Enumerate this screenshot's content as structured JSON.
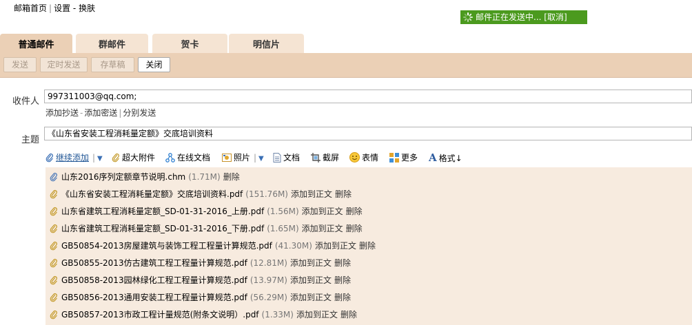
{
  "topnav": {
    "home": "邮箱首页",
    "sep": "|",
    "settings": "设置",
    "dash": "-",
    "skin": "换肤"
  },
  "status": {
    "text": "邮件正在发送中... [取消]"
  },
  "tabs": [
    "普通邮件",
    "群邮件",
    "贺卡",
    "明信片"
  ],
  "toolbar": {
    "send": "发送",
    "schedule": "定时发送",
    "draft": "存草稿",
    "close": "关闭"
  },
  "form": {
    "to_label": "收件人",
    "to_value": "997311003@qq.com;",
    "add_cc": "添加抄送",
    "add_bcc": "添加密送",
    "separate": "分别发送",
    "dash": "-",
    "bar": "|",
    "subject_label": "主题",
    "subject_value": "《山东省安装工程消耗量定额》交底培训资料"
  },
  "attach_toolbar": {
    "continue_add": "继续添加",
    "big_attach": "超大附件",
    "online_doc": "在线文档",
    "photo": "照片",
    "doc": "文档",
    "screenshot": "截屏",
    "emoji": "表情",
    "more": "更多",
    "format": "格式↓"
  },
  "attachments": [
    {
      "name": "山东2016序列定额章节说明.chm",
      "size": "(1.71M)",
      "add": "",
      "del": "删除"
    },
    {
      "name": "《山东省安装工程消耗量定额》交底培训资料.pdf",
      "size": "(151.76M)",
      "add": "添加到正文",
      "del": "删除"
    },
    {
      "name": "山东省建筑工程消耗量定额_SD-01-31-2016_上册.pdf",
      "size": "(1.56M)",
      "add": "添加到正文",
      "del": "删除"
    },
    {
      "name": "山东省建筑工程消耗量定额_SD-01-31-2016_下册.pdf",
      "size": "(1.65M)",
      "add": "添加到正文",
      "del": "删除"
    },
    {
      "name": "GB50854-2013房屋建筑与装饰工程工程量计算规范.pdf",
      "size": "(41.30M)",
      "add": "添加到正文",
      "del": "删除"
    },
    {
      "name": "GB50855-2013仿古建筑工程工程量计算规范.pdf",
      "size": "(12.81M)",
      "add": "添加到正文",
      "del": "删除"
    },
    {
      "name": "GB50858-2013园林绿化工程工程量计算规范.pdf",
      "size": "(13.97M)",
      "add": "添加到正文",
      "del": "删除"
    },
    {
      "name": "GB50856-2013通用安装工程工程量计算规范.pdf",
      "size": "(56.29M)",
      "add": "添加到正文",
      "del": "删除"
    },
    {
      "name": "GB50857-2013市政工程计量规范(附条文说明）.pdf",
      "size": "(1.33M)",
      "add": "添加到正文",
      "del": "删除"
    }
  ],
  "icons": {
    "paperclip": "paperclip-icon",
    "spinner": "loading-spinner-icon",
    "colors": {
      "accent_green": "#4b9a1e",
      "tab_bg": "#ebd0b6",
      "list_bg": "#f7ebdf",
      "link_blue": "#1e5494"
    }
  }
}
